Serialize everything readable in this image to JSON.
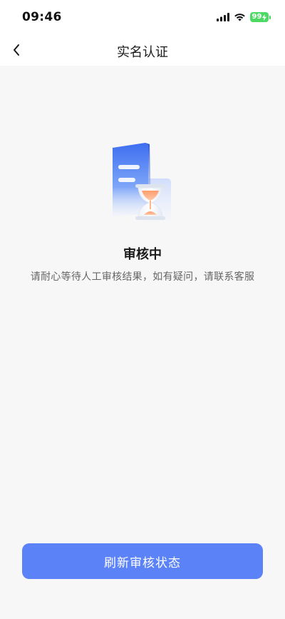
{
  "status_bar": {
    "time": "09:46",
    "battery": "99"
  },
  "nav": {
    "title": "实名认证"
  },
  "content": {
    "status_title": "审核中",
    "status_desc": "请耐心等待人工审核结果，如有疑问，请联系客服"
  },
  "actions": {
    "refresh_label": "刷新审核状态"
  },
  "colors": {
    "primary": "#5b82f7",
    "background": "#f7f7f7",
    "battery": "#4cd964"
  }
}
